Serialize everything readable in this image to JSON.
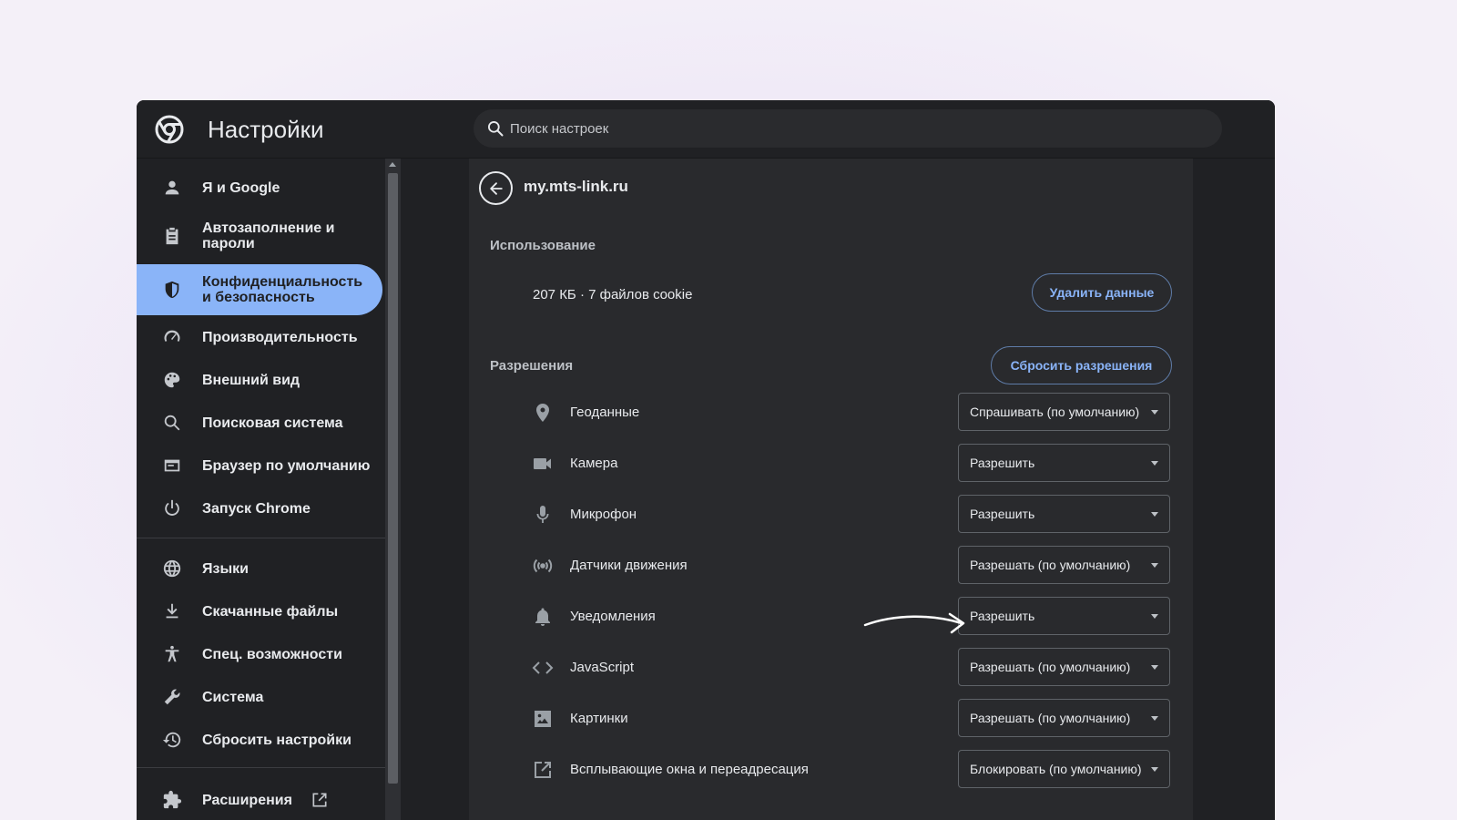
{
  "header": {
    "title": "Настройки",
    "search_placeholder": "Поиск настроек"
  },
  "sidebar": {
    "items": [
      {
        "label": "Я и Google",
        "icon": "person-icon"
      },
      {
        "label": "Автозаполнение и пароли",
        "icon": "clipboard-icon"
      },
      {
        "label": "Конфиденциальность и безопасность",
        "icon": "shield-icon",
        "active": true
      },
      {
        "label": "Производительность",
        "icon": "speedometer-icon"
      },
      {
        "label": "Внешний вид",
        "icon": "palette-icon"
      },
      {
        "label": "Поисковая система",
        "icon": "search-icon"
      },
      {
        "label": "Браузер по умолчанию",
        "icon": "browser-icon"
      },
      {
        "label": "Запуск Chrome",
        "icon": "power-icon"
      },
      {
        "label": "Языки",
        "icon": "globe-icon"
      },
      {
        "label": "Скачанные файлы",
        "icon": "download-icon"
      },
      {
        "label": "Спец. возможности",
        "icon": "accessibility-icon"
      },
      {
        "label": "Система",
        "icon": "wrench-icon"
      },
      {
        "label": "Сбросить настройки",
        "icon": "history-icon"
      },
      {
        "label": "Расширения",
        "icon": "puzzle-icon"
      }
    ]
  },
  "site": {
    "name": "my.mts-link.ru"
  },
  "usage": {
    "title": "Использование",
    "text": "207 КБ · 7 файлов cookie",
    "delete_button": "Удалить данные"
  },
  "permissions": {
    "title": "Разрешения",
    "reset_button": "Сбросить разрешения",
    "rows": [
      {
        "label": "Геоданные",
        "value": "Спрашивать (по умолчанию)",
        "icon": "location-pin-icon"
      },
      {
        "label": "Камера",
        "value": "Разрешить",
        "icon": "camera-icon"
      },
      {
        "label": "Микрофон",
        "value": "Разрешить",
        "icon": "microphone-icon"
      },
      {
        "label": "Датчики движения",
        "value": "Разрешать (по умолчанию)",
        "icon": "motion-sensor-icon"
      },
      {
        "label": "Уведомления",
        "value": "Разрешить",
        "icon": "bell-icon"
      },
      {
        "label": "JavaScript",
        "value": "Разрешать (по умолчанию)",
        "icon": "code-icon"
      },
      {
        "label": "Картинки",
        "value": "Разрешать (по умолчанию)",
        "icon": "image-icon"
      },
      {
        "label": "Всплывающие окна и переадресация",
        "value": "Блокировать (по умолчанию)",
        "icon": "open-external-icon"
      }
    ]
  },
  "colors": {
    "accent": "#8ab4f8",
    "background": "#202124",
    "surface": "#292a2d"
  }
}
